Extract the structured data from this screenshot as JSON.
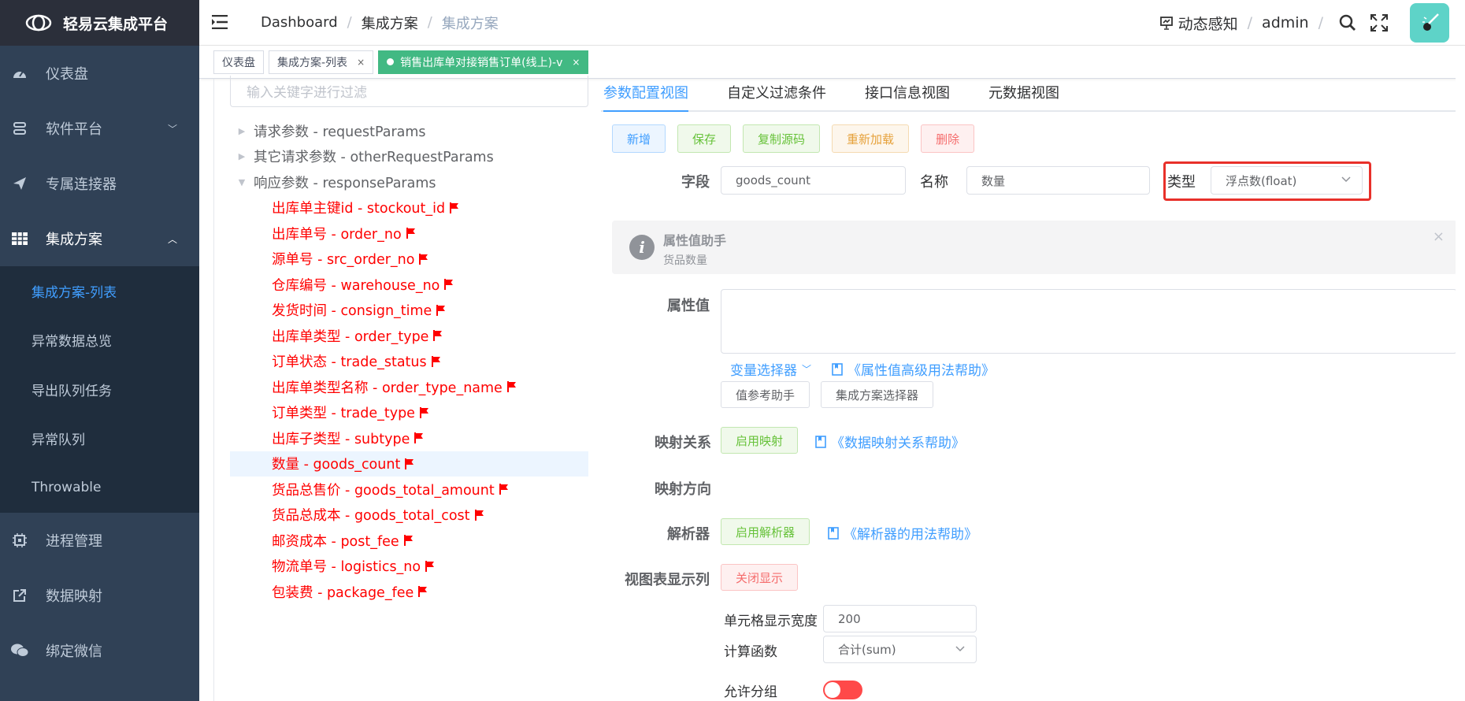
{
  "app": {
    "title": "轻易云集成平台"
  },
  "sidebar": {
    "items": [
      {
        "label": "仪表盘",
        "icon": "dashboard-icon"
      },
      {
        "label": "软件平台",
        "icon": "platform-icon",
        "arrow": "﹀"
      },
      {
        "label": "专属连接器",
        "icon": "send-icon"
      },
      {
        "label": "集成方案",
        "icon": "grid-icon",
        "arrow": "︿"
      }
    ],
    "subitems": [
      {
        "label": "集成方案-列表"
      },
      {
        "label": "异常数据总览"
      },
      {
        "label": "导出队列任务"
      },
      {
        "label": "异常队列"
      },
      {
        "label": "Throwable"
      }
    ],
    "bottom_items": [
      {
        "label": "进程管理",
        "icon": "cpu-icon"
      },
      {
        "label": "数据映射",
        "icon": "external-link-icon"
      },
      {
        "label": "绑定微信",
        "icon": "wechat-icon"
      }
    ]
  },
  "header": {
    "breadcrumb": [
      "Dashboard",
      "集成方案",
      "集成方案"
    ],
    "sep": "/",
    "notify_label": "动态感知",
    "user": "admin"
  },
  "tags": [
    {
      "label": "仪表盘"
    },
    {
      "label": "集成方案-列表",
      "close": "×"
    },
    {
      "label": "销售出库单对接销售订单(线上)-v",
      "close": "×"
    }
  ],
  "tree": {
    "filter_placeholder": "输入关键字进行过滤",
    "nodes": [
      {
        "label": "请求参数 - requestParams",
        "caret": "▶"
      },
      {
        "label": "其它请求参数 - otherRequestParams",
        "caret": "▶"
      },
      {
        "label": "响应参数 - responseParams",
        "caret": "▼"
      }
    ],
    "leaves": [
      "出库单主键id - stockout_id",
      "出库单号 - order_no",
      "源单号 - src_order_no",
      "仓库编号 - warehouse_no",
      "发货时间 - consign_time",
      "出库单类型 - order_type",
      "订单状态 - trade_status",
      "出库单类型名称 - order_type_name",
      "订单类型 - trade_type",
      "出库子类型 - subtype",
      "数量 - goods_count",
      "货品总售价 - goods_total_amount",
      "货品总成本 - goods_total_cost",
      "邮资成本 - post_fee",
      "物流单号 - logistics_no",
      "包装费 - package_fee"
    ]
  },
  "config": {
    "tabs": [
      "参数配置视图",
      "自定义过滤条件",
      "接口信息视图",
      "元数据视图"
    ],
    "buttons": [
      "新增",
      "保存",
      "复制源码",
      "重新加载",
      "删除"
    ],
    "field_label": "字段",
    "field_value": "goods_count",
    "name_label": "名称",
    "name_value": "数量",
    "type_label": "类型",
    "type_value": "浮点数(float)",
    "alert_title": "属性值助手",
    "alert_desc": "货品数量",
    "alert_close": "×",
    "alert_icon": "i",
    "attr_label": "属性值",
    "var_selector": "变量选择器",
    "var_arrow": "﹀",
    "attr_help": "《属性值高级用法帮助》",
    "ref_helper": "值参考助手",
    "scheme_selector": "集成方案选择器",
    "mapping_label": "映射关系",
    "mapping_btn": "启用映射",
    "mapping_help": "《数据映射关系帮助》",
    "direction_label": "映射方向",
    "parser_label": "解析器",
    "parser_btn": "启用解析器",
    "parser_help": "《解析器的用法帮助》",
    "view_label": "视图表显示列",
    "view_btn": "关闭显示",
    "cell_width_label": "单元格显示宽度",
    "cell_width_value": "200",
    "calc_label": "计算函数",
    "calc_value": "合计(sum)",
    "group_label": "允许分组",
    "group_enabled": false
  },
  "colors": {
    "sidebar_bg": "#304156",
    "accent": "#409eff",
    "tag_active": "#42b983",
    "leaf_text": "#ff0000",
    "highlight": "#e8302a"
  }
}
